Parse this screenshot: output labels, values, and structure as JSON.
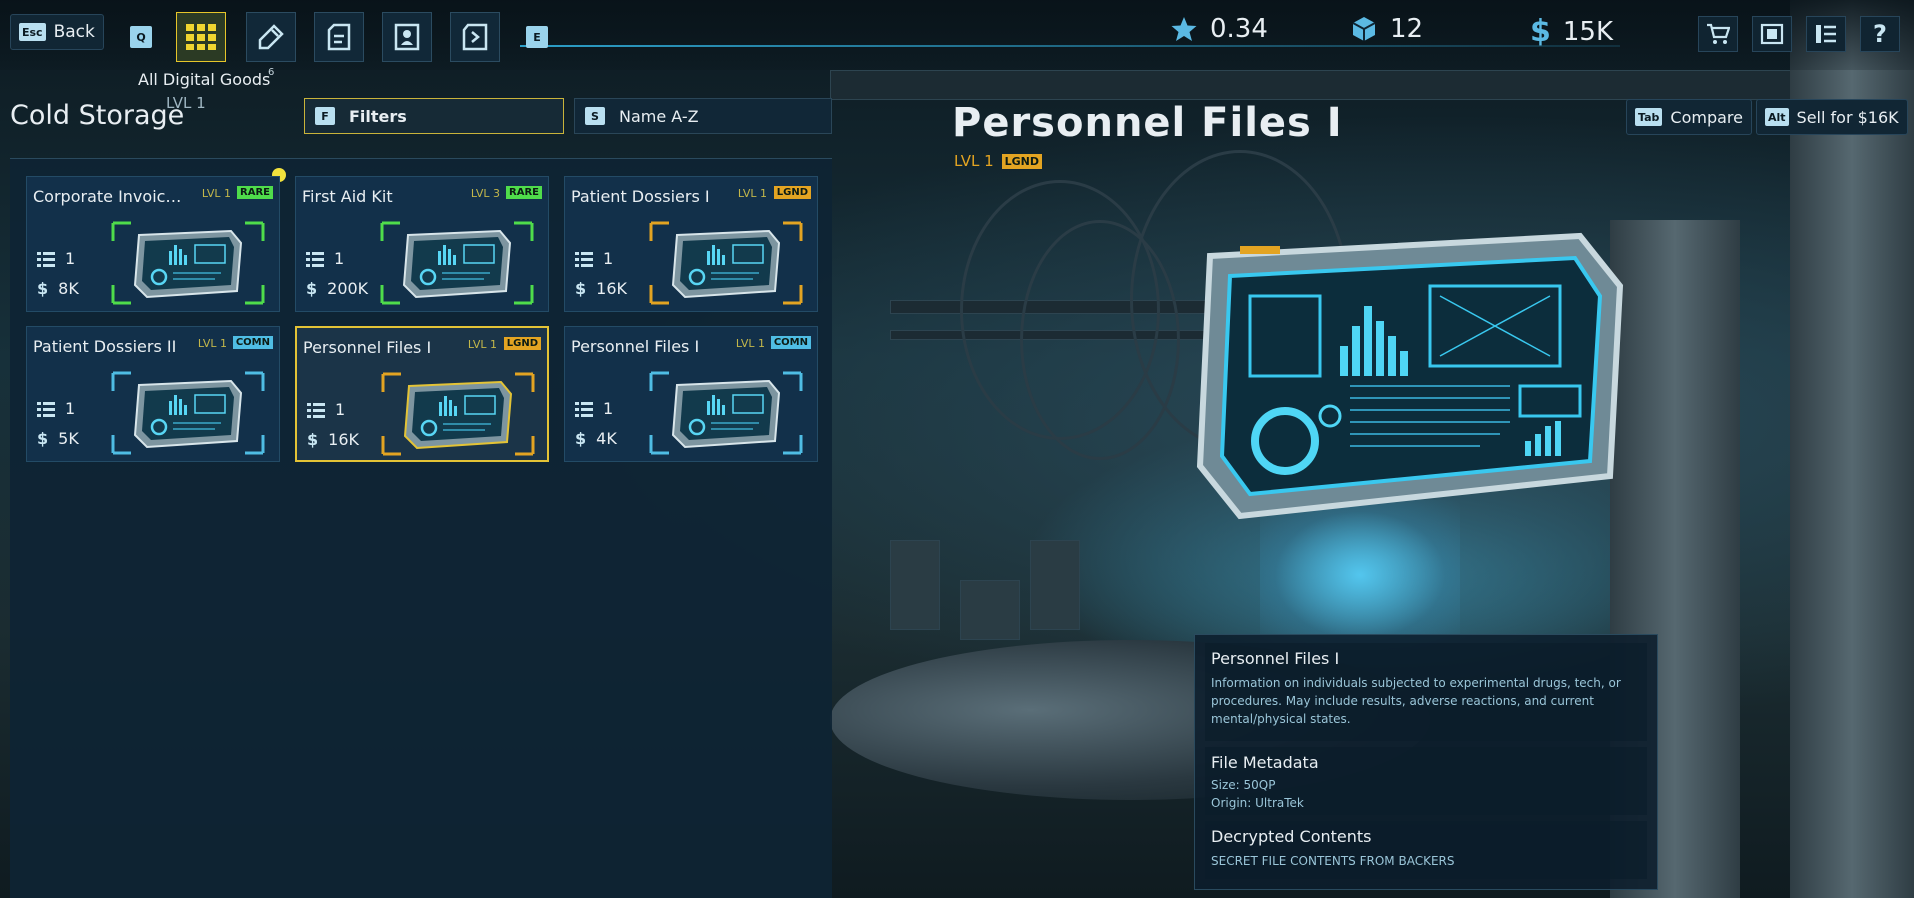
{
  "header": {
    "back": {
      "key": "Esc",
      "label": "Back"
    },
    "nav_keys": {
      "prev": "Q",
      "next": "E"
    },
    "category": {
      "label": "All Digital Goods",
      "count": "6",
      "level": "LVL 1"
    },
    "stats": {
      "rating": "0.34",
      "inventory": "12",
      "credits": "15K"
    },
    "system_icons": [
      "cart-icon",
      "storage-icon",
      "list-icon",
      "help-icon"
    ]
  },
  "left": {
    "title": "Cold Storage",
    "filter": {
      "key": "F",
      "label": "Filters"
    },
    "sort": {
      "key": "S",
      "label": "Name A-Z"
    },
    "items": [
      {
        "name": "Corporate Invoic…",
        "level": "LVL 1",
        "rarity": "RARE",
        "qty": "1",
        "value": "8K"
      },
      {
        "name": "First Aid Kit",
        "level": "LVL 3",
        "rarity": "RARE",
        "qty": "1",
        "value": "200K"
      },
      {
        "name": "Patient Dossiers I",
        "level": "LVL 1",
        "rarity": "LGND",
        "qty": "1",
        "value": "16K"
      },
      {
        "name": "Patient Dossiers II",
        "level": "LVL 1",
        "rarity": "COMN",
        "qty": "1",
        "value": "5K"
      },
      {
        "name": "Personnel Files I",
        "level": "LVL 1",
        "rarity": "LGND",
        "qty": "1",
        "value": "16K"
      },
      {
        "name": "Personnel Files I",
        "level": "LVL 1",
        "rarity": "COMN",
        "qty": "1",
        "value": "4K"
      }
    ]
  },
  "detail": {
    "title": "Personnel Files I",
    "level": "LVL 1",
    "rarity": "LGND",
    "compare": {
      "key": "Tab",
      "label": "Compare"
    },
    "sell": {
      "key": "Alt",
      "label": "Sell for $16K"
    },
    "info": {
      "name": "Personnel Files I",
      "description": "Information on individuals subjected to experimental drugs, tech, or procedures. May include results, adverse reactions, and current mental/physical states.",
      "metadata_title": "File Metadata",
      "size": "Size: 50QP",
      "origin": "Origin: UltraTek",
      "contents_title": "Decrypted Contents",
      "contents": "SECRET FILE CONTENTS FROM BACKERS"
    }
  },
  "colors": {
    "rare": "#4fdc4b",
    "legendary": "#e3a422",
    "common": "#4fbde4",
    "accent": "#e3c336"
  }
}
